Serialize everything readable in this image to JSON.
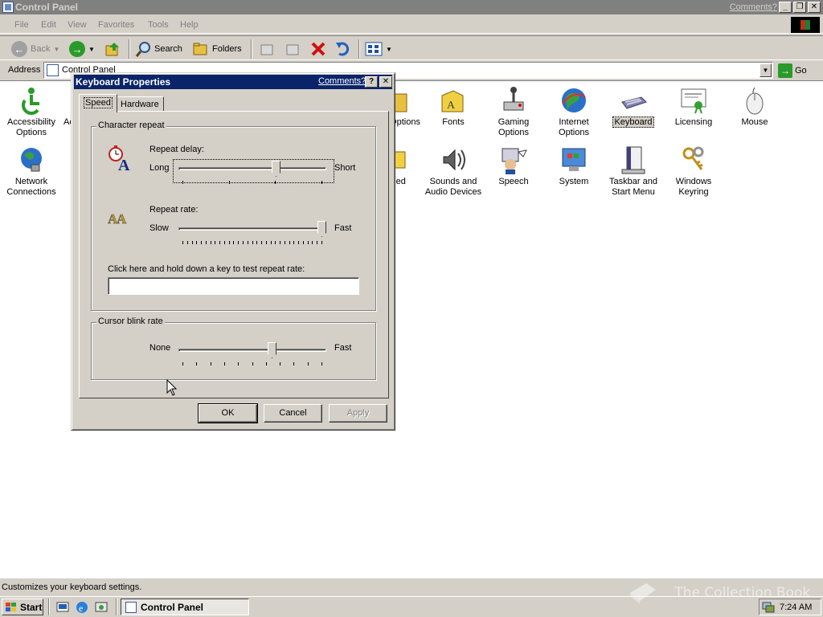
{
  "window": {
    "title": "Control Panel",
    "comments_link": "Comments?",
    "minimize": "_",
    "restore": "❐",
    "close": "✕"
  },
  "menu": [
    "File",
    "Edit",
    "View",
    "Favorites",
    "Tools",
    "Help"
  ],
  "toolbar": {
    "back": "Back",
    "search": "Search",
    "folders": "Folders"
  },
  "address": {
    "label": "Address",
    "value": "Control Panel",
    "go": "Go"
  },
  "items": [
    {
      "label": "Accessibility Options",
      "icon": "accessibility-icon"
    },
    {
      "label": "Ac",
      "icon": "add-hardware-icon"
    },
    {
      "label": "Options",
      "icon": "folder-options-icon"
    },
    {
      "label": "Fonts",
      "icon": "fonts-icon"
    },
    {
      "label": "Gaming Options",
      "icon": "gaming-icon"
    },
    {
      "label": "Internet Options",
      "icon": "internet-icon"
    },
    {
      "label": "Keyboard",
      "icon": "keyboard-icon",
      "selected": true
    },
    {
      "label": "Licensing",
      "icon": "licensing-icon"
    },
    {
      "label": "Mouse",
      "icon": "mouse-icon"
    },
    {
      "label": "Network Connections",
      "icon": "network-icon"
    },
    {
      "label": "duled ks",
      "icon": "scheduled-tasks-icon"
    },
    {
      "label": "Sounds and Audio Devices",
      "icon": "sounds-icon"
    },
    {
      "label": "Speech",
      "icon": "speech-icon"
    },
    {
      "label": "System",
      "icon": "system-icon"
    },
    {
      "label": "Taskbar and Start Menu",
      "icon": "taskbar-icon"
    },
    {
      "label": "Windows Keyring",
      "icon": "keyring-icon"
    }
  ],
  "status": "Customizes your keyboard settings.",
  "taskbar": {
    "start": "Start",
    "task": "Control Panel",
    "clock": "7:24 AM",
    "watermark": "The Collection Book"
  },
  "dialog": {
    "title": "Keyboard Properties",
    "comments": "Comments?",
    "help": "?",
    "close": "✕",
    "tabs": [
      "Speed",
      "Hardware"
    ],
    "char_repeat_group": "Character repeat",
    "repeat_delay_label": "Repeat delay:",
    "delay_left": "Long",
    "delay_right": "Short",
    "repeat_delay_level": 0.67,
    "repeat_rate_label": "Repeat rate:",
    "rate_left": "Slow",
    "rate_right": "Fast",
    "repeat_rate_level": 1.0,
    "test_label": "Click here and hold down a key to test repeat rate:",
    "test_value": "",
    "cursor_group": "Cursor blink rate",
    "blink_left": "None",
    "blink_right": "Fast",
    "blink_level": 0.64,
    "ok": "OK",
    "cancel": "Cancel",
    "apply": "Apply"
  }
}
